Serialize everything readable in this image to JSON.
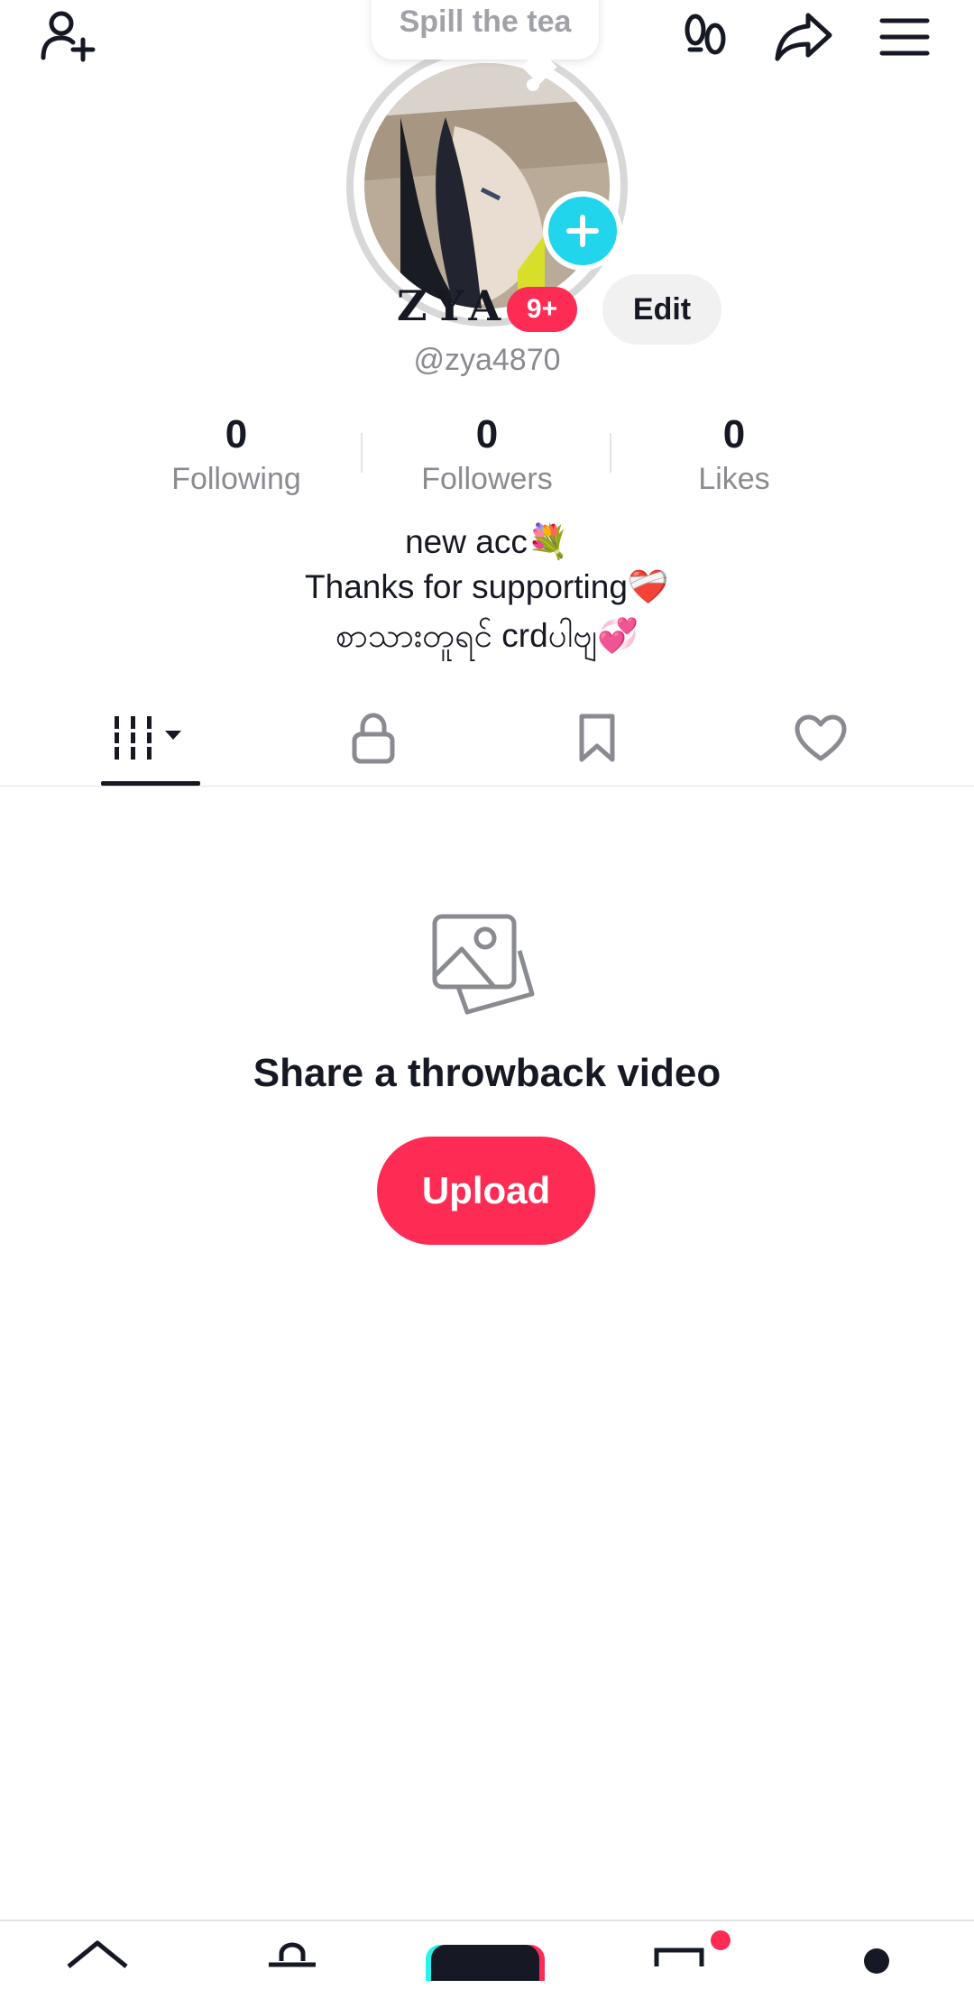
{
  "colors": {
    "accent": "#fe2c55",
    "avatar_badge": "#20d5ec",
    "text": "#161823",
    "muted": "#8a8b91"
  },
  "header": {
    "add_friend_icon": "person-add-icon",
    "footprint_icon": "footprints-icon",
    "share_icon": "share-arrow-icon",
    "menu_icon": "hamburger-menu-icon"
  },
  "profile": {
    "bubble_text": "Spill the tea",
    "name": "ZYA",
    "notification_badge": "9+",
    "edit_label": "Edit",
    "handle": "@zya4870",
    "stats": [
      {
        "value": "0",
        "label": "Following"
      },
      {
        "value": "0",
        "label": "Followers"
      },
      {
        "value": "0",
        "label": "Likes"
      }
    ],
    "bio": [
      "new acc💐",
      "Thanks for supporting❤️‍🩹",
      "စာသားတူရင် crdပါဗျ💞"
    ]
  },
  "tabs": [
    {
      "icon": "videos-grid-icon",
      "active": true
    },
    {
      "icon": "lock-icon",
      "active": false
    },
    {
      "icon": "bookmark-icon",
      "active": false
    },
    {
      "icon": "heart-icon",
      "active": false
    }
  ],
  "empty_state": {
    "icon": "photo-stack-icon",
    "title": "Share a throwback video",
    "button": "Upload"
  },
  "bottom_nav": [
    {
      "icon": "home-icon"
    },
    {
      "icon": "shop-icon"
    },
    {
      "icon": "create-plus-icon"
    },
    {
      "icon": "inbox-icon",
      "has_dot": true
    },
    {
      "icon": "profile-icon",
      "active": true
    }
  ]
}
